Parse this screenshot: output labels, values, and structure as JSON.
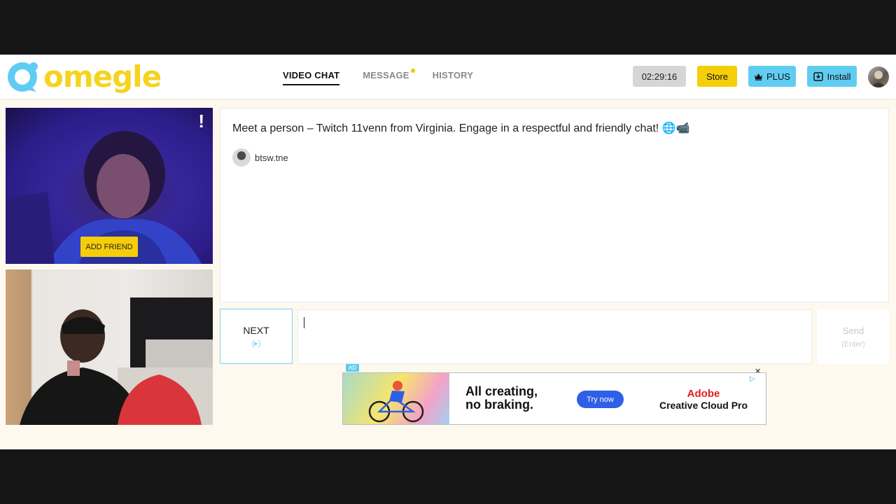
{
  "header": {
    "logo_text": "omegle",
    "nav": [
      {
        "label": "VIDEO CHAT",
        "active": true
      },
      {
        "label": "MESSAGE",
        "active": false,
        "has_dot": true
      },
      {
        "label": "HISTORY",
        "active": false
      }
    ],
    "timer": "02:29:16",
    "store_label": "Store",
    "plus_label": "PLUS",
    "install_label": "Install"
  },
  "video": {
    "stranger_flag": "!",
    "add_friend_label": "ADD FRIEND"
  },
  "chat": {
    "intro": "Meet a person – Twitch 11venn from Virginia. Engage in a respectful and friendly chat! 🌐📹",
    "user_name": "btsw.tne"
  },
  "controls": {
    "next_label": "NEXT",
    "next_hint": "(▸)",
    "send_label": "Send",
    "send_hint": "(Enter)"
  },
  "ad": {
    "tag": "AD",
    "headline_1": "All creating,",
    "headline_2": "no braking.",
    "cta": "Try now",
    "brand_1": "Adobe",
    "brand_2": "Creative Cloud Pro",
    "close": "✕",
    "choices": "▷"
  },
  "colors": {
    "accent_yellow": "#f6cd09",
    "accent_blue": "#5fcdf2",
    "logo_yellow": "#f6d31f",
    "page_bg": "#fdf9ef"
  }
}
